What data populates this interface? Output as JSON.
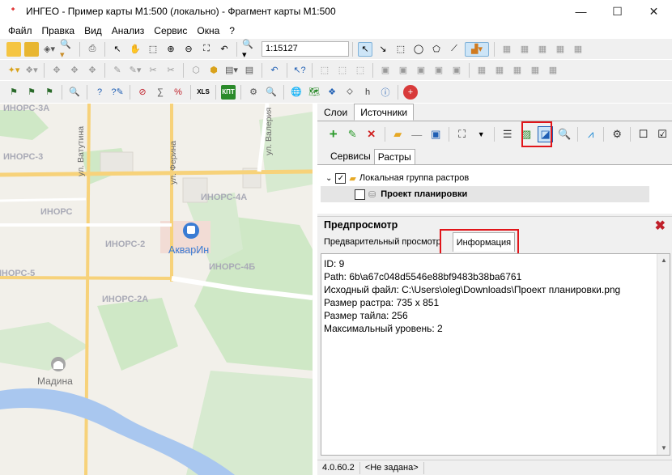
{
  "window": {
    "title": "ИНГЕО - Пример карты М1:500 (локально) - Фрагмент карты М1:500",
    "minimize": "—",
    "maximize": "☐",
    "close": "✕"
  },
  "menu": [
    "Файл",
    "Правка",
    "Вид",
    "Анализ",
    "Сервис",
    "Окна",
    "?"
  ],
  "toolbar": {
    "scale_value": "1:15127",
    "xls_label": "XLS",
    "kpt_label": "КПТ"
  },
  "map": {
    "labels": [
      "ИНОРС-3А",
      "ИНОРС-3",
      "ИНОРС",
      "ИНОРС-4А",
      "ИНОРС-2",
      "ИНОРС-4Б",
      "ИНОРС-5",
      "ИНОРС-2А"
    ],
    "roads": [
      "ул. Ватутина",
      "ул. Ферина",
      "ул. Валерия"
    ],
    "poi_aquarin": "АкварИн",
    "poi_madina": "Мадина"
  },
  "panel": {
    "tabs": [
      "Слои",
      "Источники"
    ],
    "active_tab": "Источники",
    "subtabs": [
      "Сервисы",
      "Растры"
    ],
    "tree": {
      "group_label": "Локальная группа растров",
      "item_label": "Проект планировки"
    }
  },
  "preview": {
    "title": "Предпросмотр",
    "tabs": [
      "Предварительный просмотр",
      "Информация"
    ],
    "info": {
      "id": "ID: 9",
      "path": "Path: 6b\\a67c048d5546e88bf9483b38ba6761",
      "source": "Исходный файл: C:\\Users\\oleg\\Downloads\\Проект планировки.png",
      "raster_size": "Размер растра: 735 x 851",
      "tile_size": "Размер тайла: 256",
      "max_level": "Максимальный уровень: 2"
    }
  },
  "status": {
    "version": "4.0.60.2",
    "projection": "<Не задана>"
  },
  "colors": {
    "highlight": "#e1151a",
    "map_bg": "#f2f0ea",
    "road": "#f7d27a",
    "park": "#cfe8c6",
    "river": "#a9c7ef"
  }
}
